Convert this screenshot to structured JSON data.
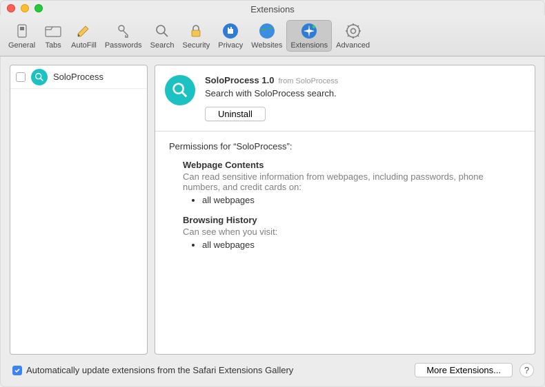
{
  "window": {
    "title": "Extensions"
  },
  "toolbar": {
    "items": [
      {
        "label": "General"
      },
      {
        "label": "Tabs"
      },
      {
        "label": "AutoFill"
      },
      {
        "label": "Passwords"
      },
      {
        "label": "Search"
      },
      {
        "label": "Security"
      },
      {
        "label": "Privacy"
      },
      {
        "label": "Websites"
      },
      {
        "label": "Extensions"
      },
      {
        "label": "Advanced"
      }
    ]
  },
  "sidebar": {
    "extension": {
      "name": "SoloProcess"
    }
  },
  "detail": {
    "name_version": "SoloProcess 1.0",
    "from": "from SoloProcess",
    "description": "Search with SoloProcess search.",
    "uninstall_label": "Uninstall"
  },
  "permissions": {
    "title": "Permissions for “SoloProcess”:",
    "blocks": [
      {
        "title": "Webpage Contents",
        "desc": "Can read sensitive information from webpages, including passwords, phone numbers, and credit cards on:",
        "items": [
          "all webpages"
        ]
      },
      {
        "title": "Browsing History",
        "desc": "Can see when you visit:",
        "items": [
          "all webpages"
        ]
      }
    ]
  },
  "footer": {
    "auto_update_label": "Automatically update extensions from the Safari Extensions Gallery",
    "more_label": "More Extensions...",
    "help_label": "?"
  }
}
